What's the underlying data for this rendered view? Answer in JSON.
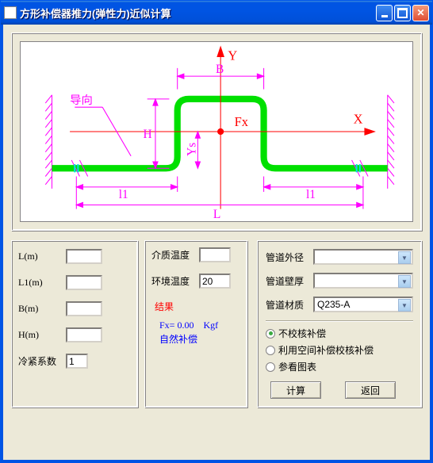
{
  "window": {
    "title": "方形补偿器推力(弹性力)近似计算"
  },
  "diagram": {
    "y_axis": "Y",
    "x_axis": "X",
    "force": "Fx",
    "label_B": "B",
    "label_H": "H",
    "label_L": "L",
    "label_l1_left": "l1",
    "label_l1_right": "l1",
    "label_Ys": "Ys",
    "guide": "导向"
  },
  "inputs": {
    "L": {
      "label": "L(m)",
      "value": ""
    },
    "L1": {
      "label": "L1(m)",
      "value": ""
    },
    "B": {
      "label": "B(m)",
      "value": ""
    },
    "H": {
      "label": "H(m)",
      "value": ""
    },
    "cold": {
      "label": "冷紧系数",
      "value": "1"
    }
  },
  "temps": {
    "medium": {
      "label": "介质温度",
      "value": ""
    },
    "env": {
      "label": "环境温度",
      "value": "20"
    }
  },
  "result": {
    "head": "结果",
    "line1_prefix": "Fx=",
    "line1_value": " 0.00",
    "line1_unit": "Kgf",
    "line2": "自然补偿"
  },
  "pipe": {
    "od": {
      "label": "管道外径",
      "value": ""
    },
    "thk": {
      "label": "管道壁厚",
      "value": ""
    },
    "mat": {
      "label": "管道材质",
      "value": "Q235-A"
    }
  },
  "options": {
    "a": "不校核补偿",
    "b": "利用空间补偿校核补偿",
    "c": "参看图表",
    "selected": "a"
  },
  "buttons": {
    "calc": "计算",
    "back": "返回"
  }
}
